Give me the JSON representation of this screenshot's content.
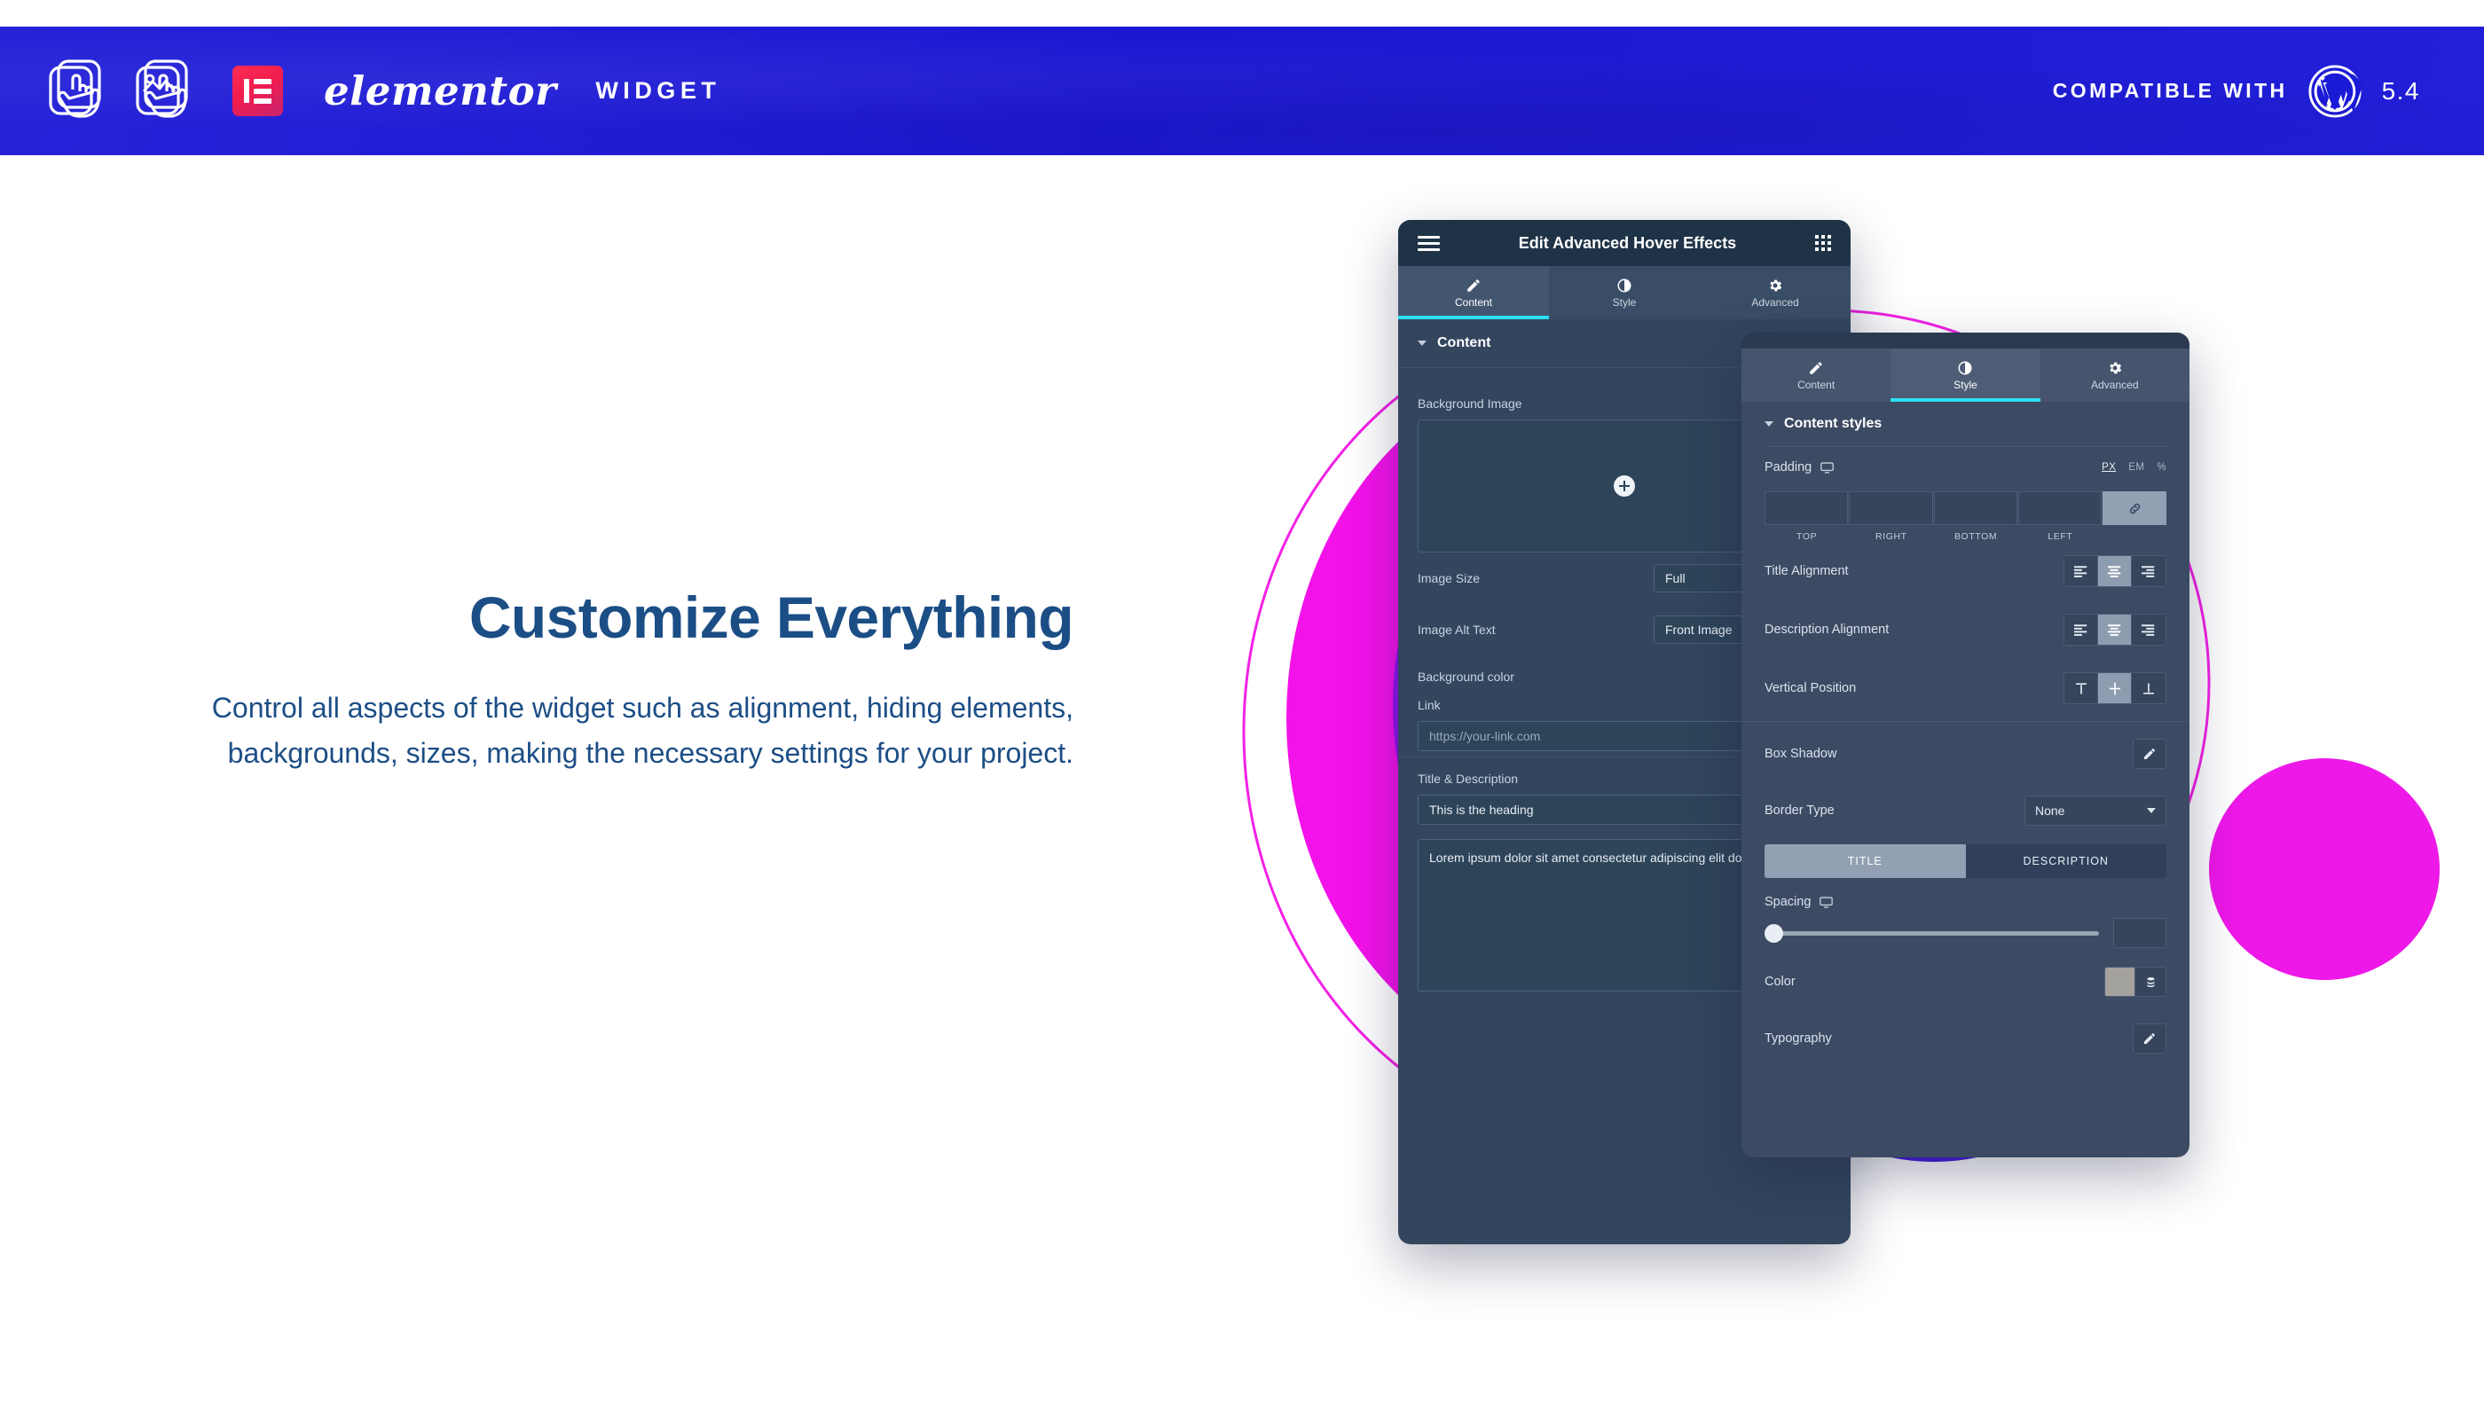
{
  "header": {
    "brand_icons": [
      "card-hand-icon",
      "image-card-hand-icon"
    ],
    "wordmark": "elementor",
    "widget_word": "WIDGET",
    "compatible_label": "COMPATIBLE WITH",
    "wp_icon": "wordpress-icon",
    "wp_version": "5.4",
    "bar_color": "#1b1ad6",
    "logo_gradient_from": "#ff2d55",
    "logo_gradient_to": "#c8236f"
  },
  "copy": {
    "headline": "Customize Everything",
    "body": "Control all aspects of the widget such as alignment, hiding elements, backgrounds, sizes, making the necessary settings for your project.",
    "text_color": "#1c4e86"
  },
  "content_panel": {
    "titlebar": {
      "menu_icon": "hamburger-icon",
      "title": "Edit Advanced Hover Effects",
      "grid_icon": "apps-grid-icon"
    },
    "tabs": [
      {
        "label": "Content",
        "icon": "pencil-icon",
        "active": true
      },
      {
        "label": "Style",
        "icon": "contrast-icon",
        "active": false
      },
      {
        "label": "Advanced",
        "icon": "gear-icon",
        "active": false
      }
    ],
    "section_title": "Content",
    "fields": {
      "background_image_label": "Background Image",
      "background_image_add_icon": "plus-circle-icon",
      "image_size_label": "Image Size",
      "image_size_value": "Full",
      "image_alt_label": "Image Alt Text",
      "image_alt_value": "Front Image",
      "background_color_label": "Background color",
      "link_label": "Link",
      "link_placeholder": "https://your-link.com",
      "title_desc_label": "Title & Description",
      "title_value": "This is the heading",
      "description_value": "Lorem ipsum dolor sit amet consectetur adipiscing elit dolor"
    },
    "accent_underline": "#29e0f5"
  },
  "style_panel": {
    "tabs": [
      {
        "label": "Content",
        "icon": "pencil-icon",
        "active": false
      },
      {
        "label": "Style",
        "icon": "contrast-icon",
        "active": true
      },
      {
        "label": "Advanced",
        "icon": "gear-icon",
        "active": false
      }
    ],
    "section_title": "Content styles",
    "padding": {
      "label": "Padding",
      "device_icon": "monitor-icon",
      "units": [
        "PX",
        "EM",
        "%"
      ],
      "unit_selected": "PX",
      "sides": [
        "TOP",
        "RIGHT",
        "BOTTOM",
        "LEFT"
      ],
      "values": [
        "",
        "",
        "",
        ""
      ],
      "link_icon": "link-chain-icon"
    },
    "title_alignment": {
      "label": "Title Alignment",
      "options": [
        "left",
        "center",
        "right"
      ],
      "selected": "center"
    },
    "description_alignment": {
      "label": "Description Alignment",
      "options": [
        "left",
        "center",
        "right"
      ],
      "selected": "center"
    },
    "vertical_position": {
      "label": "Vertical Position",
      "options": [
        "top",
        "middle",
        "bottom"
      ],
      "selected": "middle"
    },
    "box_shadow": {
      "label": "Box Shadow",
      "edit_icon": "pencil-edit-icon"
    },
    "border_type": {
      "label": "Border Type",
      "value": "None"
    },
    "title_desc_toggle": {
      "options": [
        "TITLE",
        "DESCRIPTION"
      ],
      "selected": "TITLE"
    },
    "spacing": {
      "label": "Spacing",
      "device_icon": "monitor-icon",
      "value": "",
      "knob_percent": 0
    },
    "color": {
      "label": "Color",
      "swatch": "#a3a29d",
      "stack_icon": "color-stack-icon"
    },
    "typography": {
      "label": "Typography",
      "edit_icon": "pencil-edit-icon"
    },
    "accent_underline": "#29e0f5"
  },
  "decor": {
    "ring_outline": "#f321e6",
    "magenta": "#f312ea",
    "violet": "#8a12ec",
    "purple": "#6a11e0",
    "blue": "#3d14e0",
    "deep_blue": "#2f17cf"
  }
}
